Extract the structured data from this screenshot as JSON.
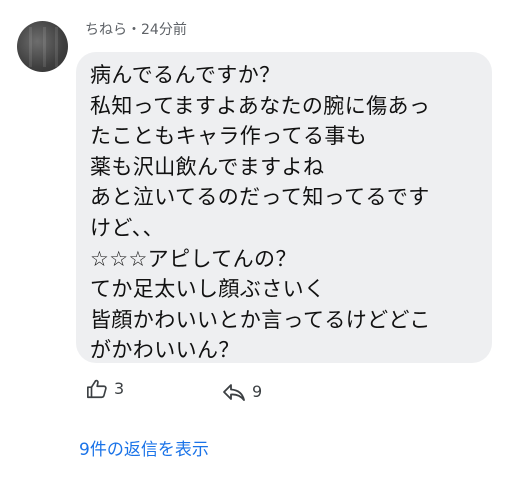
{
  "comment": {
    "author": "ちねら",
    "separator": "・",
    "time": "24分前",
    "body": "病んでるんですか？\n私知ってますよあなたの腕に傷あっ\nたこともキャラ作ってる事も\n薬も沢山飲んでますよね\nあと泣いてるのだって知ってるです\nけど、、\n☆☆☆アピしてんの？\nてか足太いし顔ぶさいく\n皆顔かわいいとか言ってるけどどこ\nがかわいいん？"
  },
  "actions": {
    "like_count": "3",
    "like_icon": "thumbs-up-icon",
    "reply_count": "9",
    "reply_icon": "reply-arrow-icon"
  },
  "replies": {
    "link_label": "9件の返信を表示",
    "link_color": "#1a73e8"
  },
  "colors": {
    "bubble_background": "#eeeff1",
    "meta_text": "#5f6368"
  }
}
